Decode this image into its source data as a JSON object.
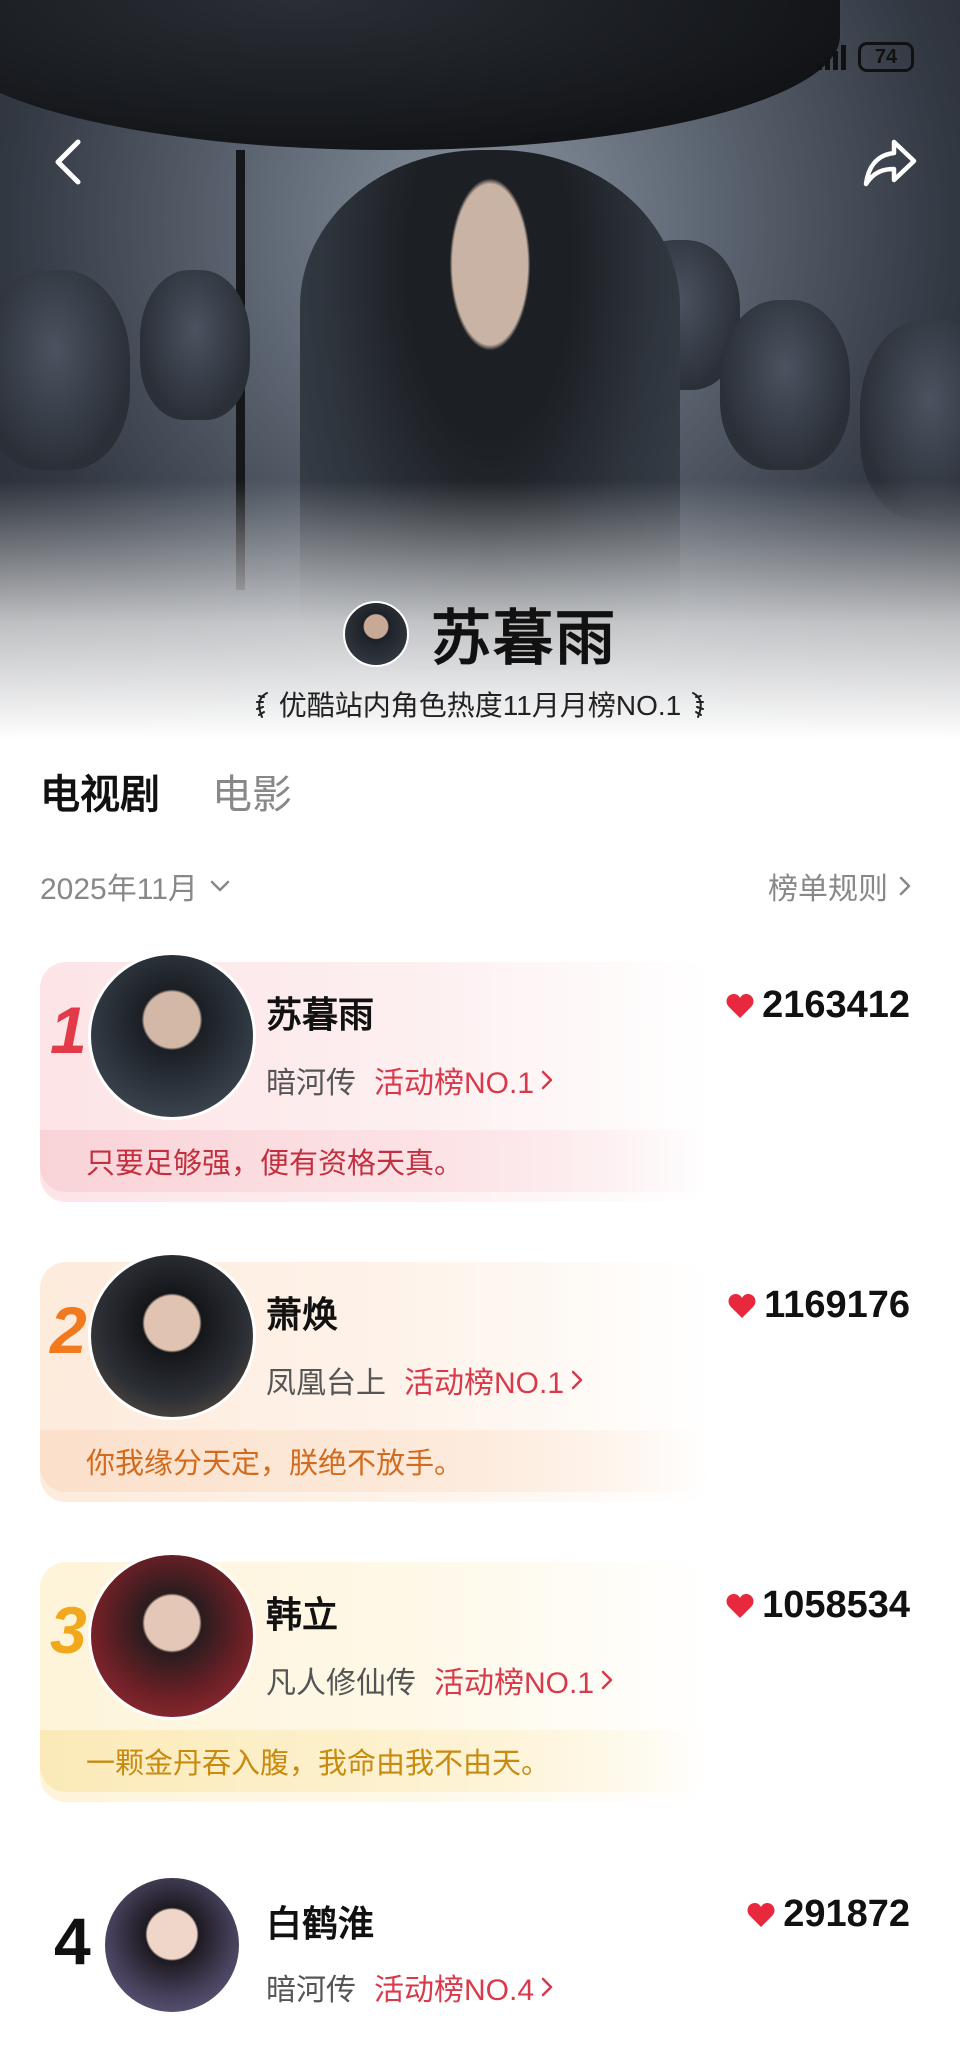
{
  "status": {
    "battery": "74"
  },
  "hero": {
    "name": "苏暮雨",
    "subtitle": "优酷站内角色热度11月月榜NO.1"
  },
  "tabs": [
    {
      "label": "电视剧",
      "active": true
    },
    {
      "label": "电影",
      "active": false
    }
  ],
  "filter": {
    "month": "2025年11月",
    "rules": "榜单规则"
  },
  "ranking": [
    {
      "rank": "1",
      "name": "苏暮雨",
      "drama": "暗河传",
      "activity": "活动榜NO.1",
      "score": "2163412",
      "quote": "只要足够强，便有资格天真。"
    },
    {
      "rank": "2",
      "name": "萧焕",
      "drama": "凤凰台上",
      "activity": "活动榜NO.1",
      "score": "1169176",
      "quote": "你我缘分天定，朕绝不放手。"
    },
    {
      "rank": "3",
      "name": "韩立",
      "drama": "凡人修仙传",
      "activity": "活动榜NO.1",
      "score": "1058534",
      "quote": "一颗金丹吞入腹，我命由我不由天。"
    },
    {
      "rank": "4",
      "name": "白鹤淮",
      "drama": "暗河传",
      "activity": "活动榜NO.4",
      "score": "291872"
    }
  ],
  "colors": {
    "heart": "#e8283c",
    "activity": "#d9394a",
    "rank1": "#e23a49",
    "rank2": "#f07a1d",
    "rank3": "#f2a81d"
  },
  "icons": {
    "back": "chevron-left-icon",
    "share": "share-arrow-icon",
    "dropdown": "chevron-down-icon",
    "more": "chevron-right-icon",
    "heat": "heart-icon"
  }
}
